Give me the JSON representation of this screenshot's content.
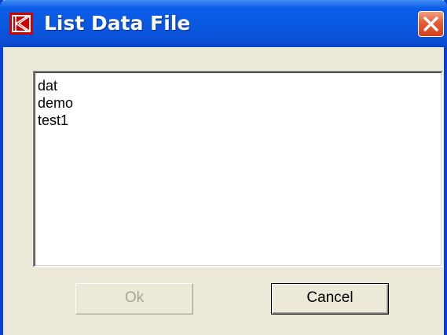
{
  "window": {
    "title": "List Data File"
  },
  "listbox": {
    "items": [
      "dat",
      "demo",
      "test1"
    ]
  },
  "buttons": {
    "ok_label": "Ok",
    "cancel_label": "Cancel"
  },
  "colors": {
    "titlebar": "#0a58e0",
    "close_button": "#e25d33",
    "dialog_background": "#ece9d8",
    "app_icon": "#d40000"
  },
  "icons": {
    "app": "k-logo-icon",
    "close": "close-icon"
  }
}
